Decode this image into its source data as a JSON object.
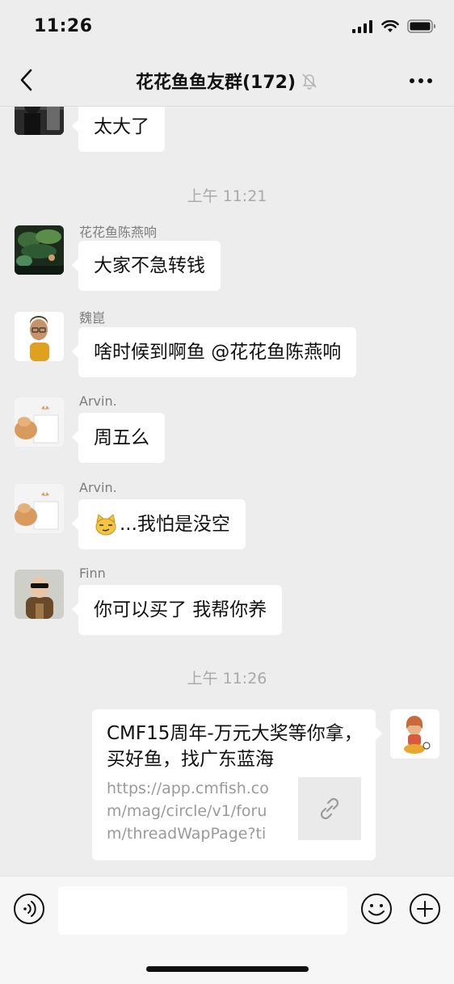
{
  "status_bar": {
    "time": "11:26"
  },
  "header": {
    "title": "花花鱼鱼友群(172)",
    "muted_icon": "bell-slash-icon",
    "more_icon": "more-dots-icon",
    "back_icon": "chevron-left-icon"
  },
  "messages": [
    {
      "bubble": "太大了"
    },
    {
      "sender": "花花鱼陈燕响",
      "bubble": "大家不急转钱"
    },
    {
      "sender": "魏崑",
      "bubble": "啥时候到啊鱼 @花花鱼陈燕响"
    },
    {
      "sender": "Arvin.",
      "bubble": "周五么"
    },
    {
      "sender": "Arvin.",
      "bubble": "...我怕是没空"
    },
    {
      "sender": "Finn",
      "bubble": "你可以买了 我帮你养"
    }
  ],
  "timestamps": [
    "上午 11:21",
    "上午 11:26"
  ],
  "link_card": {
    "title": "CMF15周年-万元大奖等你拿，买好鱼，找广东蓝海",
    "url": "https://app.cmfish.com/mag/circle/v1/forum/threadWapPage?tid...",
    "thumb_icon": "link-icon"
  },
  "input_bar": {
    "voice_icon": "voice-icon",
    "emoji_icon": "emoji-icon",
    "plus_icon": "plus-icon"
  },
  "colors": {
    "background": "#ededed",
    "bubble": "#ffffff",
    "timestamp": "#a9a9a9"
  }
}
